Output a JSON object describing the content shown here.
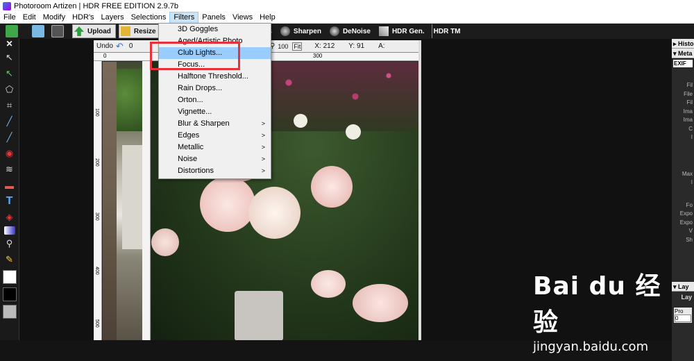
{
  "window": {
    "title": "Photoroom Artizen | HDR FREE EDITION 2.9.7b"
  },
  "menubar": [
    "File",
    "Edit",
    "Modify",
    "HDR's",
    "Layers",
    "Selections",
    "Filters",
    "Panels",
    "Views",
    "Help"
  ],
  "toolbar": {
    "buttons": [
      {
        "label": "Upload",
        "icon": "upload-arrow-icon"
      },
      {
        "label": "Resize",
        "icon": "resize-icon"
      },
      {
        "label": "lors",
        "icon": "colors-icon"
      },
      {
        "label": "Sharpen",
        "icon": "sharpen-icon"
      },
      {
        "label": "DeNoise",
        "icon": "denoise-icon"
      },
      {
        "label": "HDR Gen.",
        "icon": "hdr-gen-icon"
      },
      {
        "label": "HDR TM",
        "icon": "hdr-tm-icon"
      }
    ]
  },
  "left_tools": {
    "close": "✕"
  },
  "doc1": {
    "undo": "Undo",
    "zoom_partial": "0",
    "ruler_h": "0",
    "ruler_v": [
      "100",
      "200",
      "300",
      "400",
      "500"
    ]
  },
  "doc2": {
    "undo": "Undo",
    "zoom": "100",
    "fit": "Fit",
    "x_label": "X: 212",
    "y_label": "Y: 91",
    "a_label": "A:",
    "ruler_h": [
      "300"
    ],
    "ruler_v": [
      "100",
      "200",
      "300",
      "400",
      "500"
    ]
  },
  "filters_menu": {
    "items": [
      {
        "label": "3D Goggles",
        "submenu": false,
        "highlighted": false
      },
      {
        "label": "Aged/Artistic Photo",
        "submenu": false,
        "highlighted": false
      },
      {
        "label": "Club Lights...",
        "submenu": false,
        "highlighted": true
      },
      {
        "label": "Focus...",
        "submenu": false,
        "highlighted": false
      },
      {
        "label": "Halftone Threshold...",
        "submenu": false,
        "highlighted": false
      },
      {
        "label": "Rain Drops...",
        "submenu": false,
        "highlighted": false
      },
      {
        "label": "Orton...",
        "submenu": false,
        "highlighted": false
      },
      {
        "label": "Vignette...",
        "submenu": false,
        "highlighted": false
      },
      {
        "label": "Blur & Sharpen",
        "submenu": true,
        "highlighted": false
      },
      {
        "label": "Edges",
        "submenu": true,
        "highlighted": false
      },
      {
        "label": "Metallic",
        "submenu": true,
        "highlighted": false
      },
      {
        "label": "Noise",
        "submenu": true,
        "highlighted": false
      },
      {
        "label": "Distortions",
        "submenu": true,
        "highlighted": false
      }
    ],
    "highlight_color": "#99ccff"
  },
  "right_panel": {
    "history": "Histo",
    "meta": "Meta",
    "exif": "EXIF",
    "layers": "Lay",
    "layers_sub": "Lay",
    "props": "Pro",
    "meta_rows": [
      "Fil",
      "File",
      "Fil",
      "Ima",
      "Ima",
      "C",
      "I",
      "Max",
      "I",
      "Fo",
      "Expo",
      "Expo",
      "V",
      "Sh"
    ],
    "value": "0"
  },
  "watermark": {
    "brand": "Bai du 经验",
    "url": "jingyan.baidu.com"
  },
  "colors": {
    "annotation": "#e8313b",
    "canvas_bg": "#141414"
  }
}
